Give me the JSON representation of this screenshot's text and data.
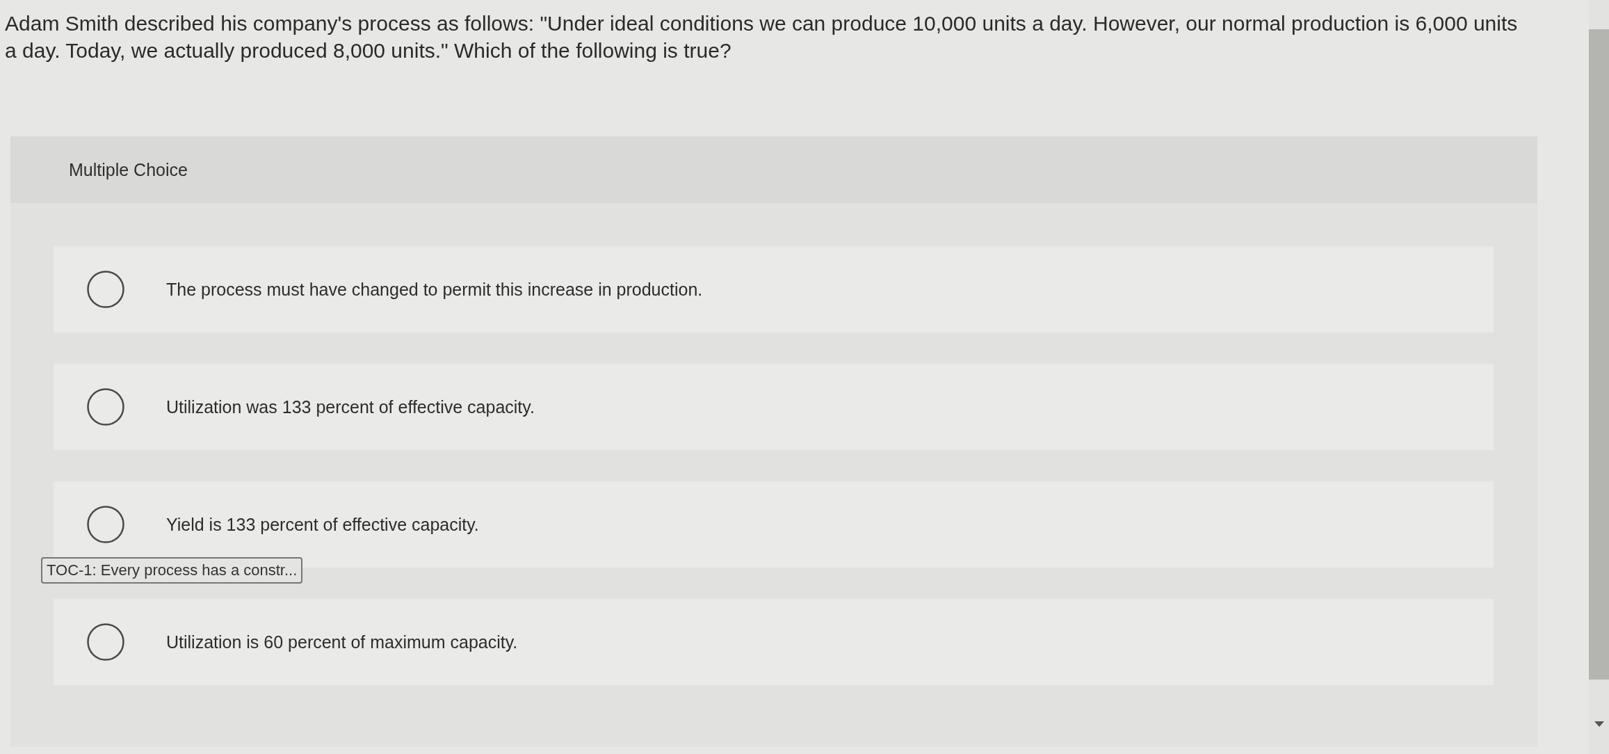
{
  "question": {
    "text": "Adam Smith described his company's process as follows: \"Under ideal conditions we can produce 10,000 units a day. However, our normal production is 6,000 units a day. Today, we actually produced 8,000 units.\" Which of the following is true?"
  },
  "answer_panel": {
    "heading": "Multiple Choice",
    "options": [
      {
        "label": "The process must have changed to permit this increase in production.",
        "selected": false
      },
      {
        "label": "Utilization was 133 percent of effective capacity.",
        "selected": false
      },
      {
        "label": "Yield is 133 percent of effective capacity.",
        "selected": false
      },
      {
        "label": "Utilization is 60 percent of maximum capacity.",
        "selected": false
      }
    ]
  },
  "tooltip": {
    "text": "TOC-1: Every process has a constr..."
  }
}
